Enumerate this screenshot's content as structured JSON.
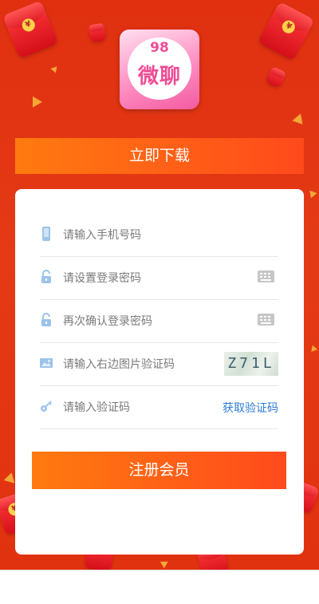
{
  "logo": {
    "number": "98",
    "name": "微聊"
  },
  "download_button": {
    "label": "立即下载"
  },
  "form": {
    "phone": {
      "placeholder": "请输入手机号码"
    },
    "password": {
      "placeholder": "请设置登录密码"
    },
    "confirm_password": {
      "placeholder": "再次确认登录密码"
    },
    "image_code": {
      "placeholder": "请输入右边图片验证码",
      "captcha_text": "Z71L"
    },
    "sms_code": {
      "placeholder": "请输入验证码",
      "get_code_label": "获取验证码"
    }
  },
  "register_button": {
    "label": "注册会员"
  },
  "colors": {
    "background": "#e1320f",
    "button_start": "#ff7a10",
    "button_end": "#ff4a1c",
    "link": "#2e7bd6",
    "logo_pink": "#ef4c95"
  },
  "icons": [
    "phone-icon",
    "lock-icon",
    "keyboard-icon",
    "image-icon",
    "key-icon",
    "red-envelope-icon"
  ]
}
